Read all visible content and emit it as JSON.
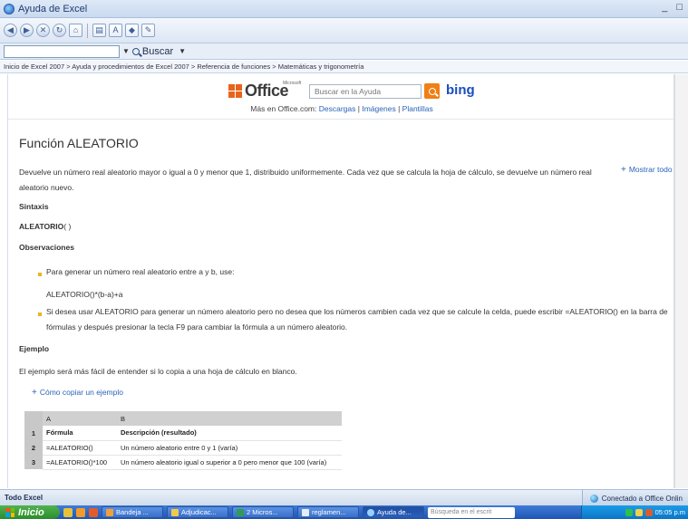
{
  "window": {
    "title": "Ayuda de Excel",
    "controls": [
      "_",
      "□"
    ]
  },
  "toolbar": {
    "icons": [
      "back-icon",
      "forward-icon",
      "stop-icon",
      "refresh-icon",
      "home-icon",
      "print-icon",
      "text-size-icon",
      "book-icon",
      "pin-icon"
    ],
    "search_label": "Buscar"
  },
  "breadcrumb": "Inicio de Excel 2007 > Ayuda y procedimientos de Excel 2007 > Referencia de funciones > Matemáticas y trigonometría",
  "banner": {
    "office_logo": "Office",
    "office_small": "Microsoft",
    "search_placeholder": "Buscar en la Ayuda",
    "bing": "bing",
    "more_prefix": "Más en Office.com:",
    "more_links": [
      "Descargas",
      "Imágenes",
      "Plantillas"
    ],
    "more_sep": "|"
  },
  "article": {
    "title": "Función ALEATORIO",
    "intro": "Devuelve un número real aleatorio mayor o igual a 0 y menor que 1, distribuido uniformemente. Cada vez que se calcula la hoja de cálculo, se devuelve un número real aleatorio nuevo.",
    "show_all": "Mostrar todo",
    "syntax_header": "Sintaxis",
    "syntax_func": "ALEATORIO",
    "syntax_args": "( )",
    "remarks_header": "Observaciones",
    "remark1": "Para generar un número real aleatorio entre a y b, use:",
    "formula": "ALEATORIO()*(b-a)+a",
    "remark2": "Si desea usar ALEATORIO para generar un número aleatorio pero no desea que los números cambien cada vez que se calcule la celda, puede escribir =ALEATORIO() en la barra de fórmulas y después presionar la tecla F9 para cambiar la fórmula a un número aleatorio.",
    "example_header": "Ejemplo",
    "example_text": "El ejemplo será más fácil de entender si lo copia a una hoja de cálculo en blanco.",
    "copy_link": "Cómo copiar un ejemplo",
    "table": {
      "col_headers": [
        "A",
        "B"
      ],
      "rows": [
        {
          "num": "1",
          "a": "Fórmula",
          "b": "Descripción (resultado)"
        },
        {
          "num": "2",
          "a": "=ALEATORIO()",
          "b": "Un número aleatorio entre 0 y 1 (varía)"
        },
        {
          "num": "3",
          "a": "=ALEATORIO()*100",
          "b": "Un número aleatorio igual o superior a 0 pero menor que 100 (varía)"
        }
      ]
    }
  },
  "status": {
    "left": "Todo Excel",
    "right": "Conectado a Office Onlin"
  },
  "taskbar": {
    "start": "Inicio",
    "tasks": [
      "Bandeja ...",
      "Adjudicac...",
      "2 Micros...",
      "reglamen...",
      "Ayuda de..."
    ],
    "search_placeholder": "Búsqueda en el escrit",
    "clock": "05:05 p.m"
  },
  "colors": {
    "link": "#2a63b8",
    "bullet": "#e9b521",
    "office_orange": "#e8641a",
    "taskbar_blue": "#1f55b4"
  }
}
